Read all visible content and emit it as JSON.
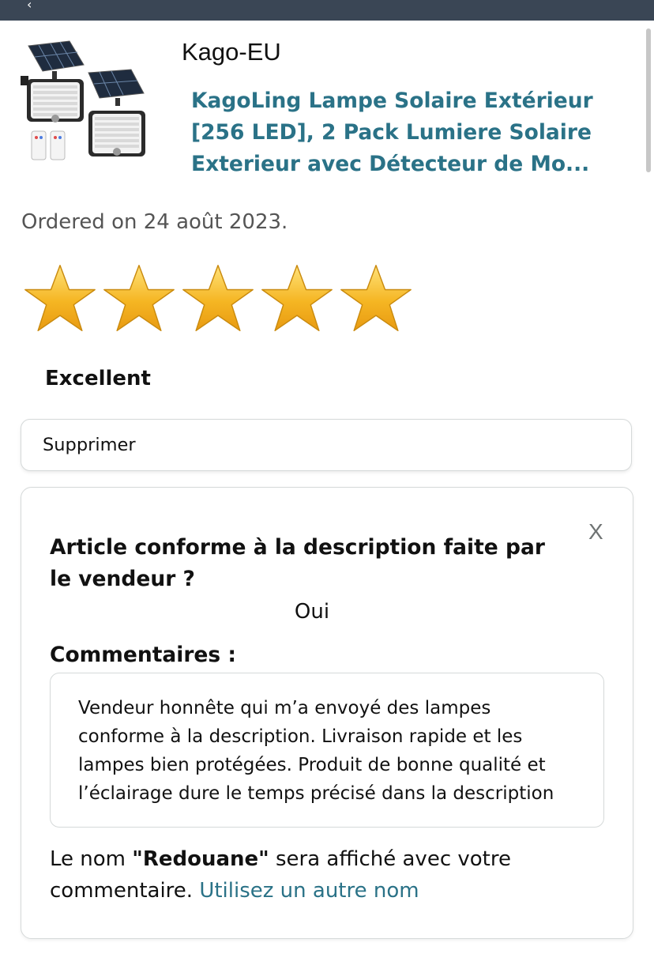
{
  "colors": {
    "topbar": "#3a4655",
    "link": "#2a7287",
    "star_fill": "#f5b623",
    "border": "#d5d9d9"
  },
  "header": {
    "back_icon": "chevron-left-icon"
  },
  "product": {
    "seller": "Kago-EU",
    "title": "KagoLing Lampe Solaire Extérieur [256 LED], 2 Pack Lumiere Solaire Exterieur avec Détecteur de Mo...",
    "image": "solar-lamp-product-image"
  },
  "order": {
    "ordered_text": "Ordered on 24 août 2023."
  },
  "rating": {
    "stars": 5,
    "max_stars": 5,
    "label": "Excellent"
  },
  "actions": {
    "delete_label": "Supprimer"
  },
  "feedback": {
    "close_label": "X",
    "question": "Article conforme à la description faite par le vendeur ?",
    "answer": "Oui",
    "comments_label": "Commentaires :",
    "comment_text": "Vendeur honnête qui m’a envoyé des lampes conforme à la description. Livraison rapide et les lampes bien protégées. Produit de bonne qualité et l’éclairage dure le temps précisé dans la description",
    "name_note_prefix": "Le nom ",
    "name": "\"Redouane\"",
    "name_note_suffix": " sera affiché avec votre commentaire. ",
    "other_name_link": "Utilisez un autre nom"
  }
}
